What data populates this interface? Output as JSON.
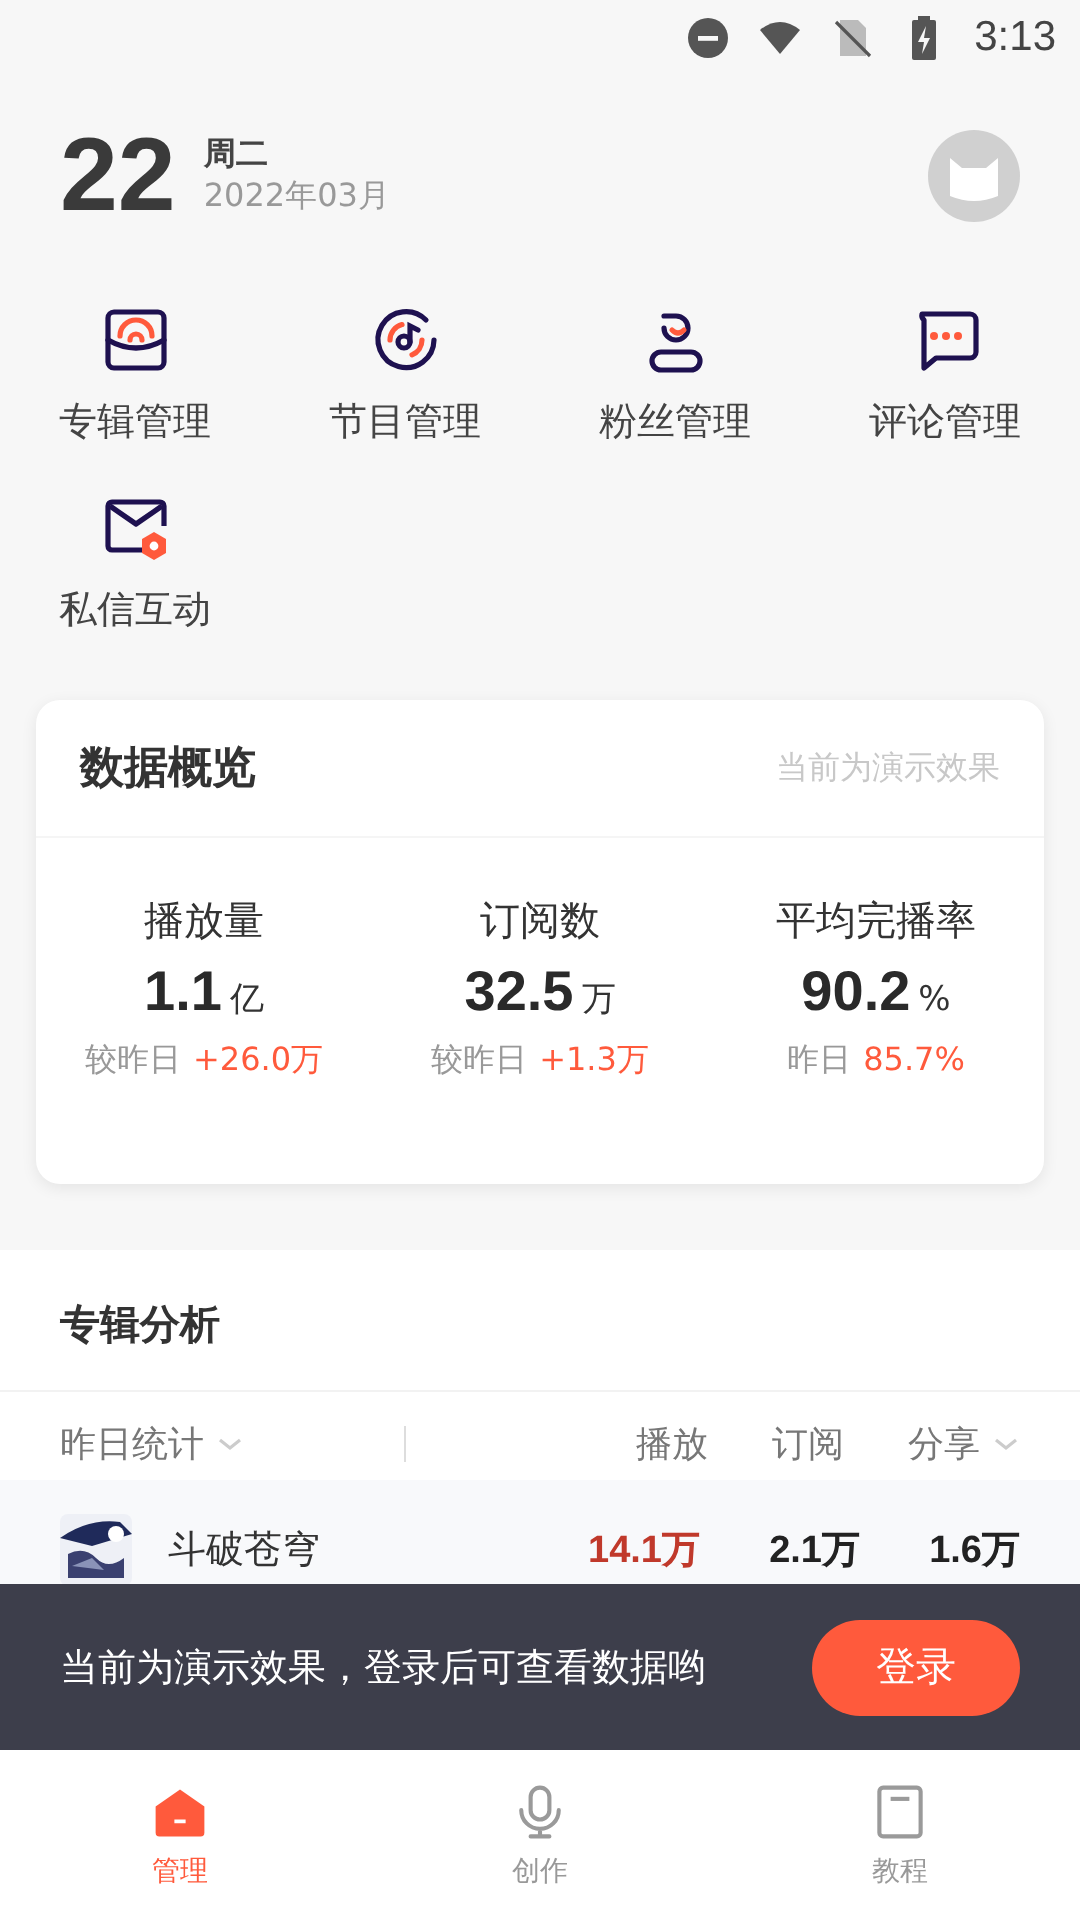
{
  "status_bar": {
    "time": "3:13"
  },
  "header": {
    "day": "22",
    "weekday": "周二",
    "month": "2022年03月"
  },
  "shortcuts": [
    {
      "label": "专辑管理",
      "kind": "album"
    },
    {
      "label": "节目管理",
      "kind": "program"
    },
    {
      "label": "粉丝管理",
      "kind": "fans"
    },
    {
      "label": "评论管理",
      "kind": "comment"
    },
    {
      "label": "私信互动",
      "kind": "message"
    }
  ],
  "overview": {
    "title": "数据概览",
    "note": "当前为演示效果",
    "stats": [
      {
        "label": "播放量",
        "value": "1.1",
        "unit": "亿",
        "compare_label": "较昨日",
        "compare_value": "+26.0万"
      },
      {
        "label": "订阅数",
        "value": "32.5",
        "unit": "万",
        "compare_label": "较昨日",
        "compare_value": "+1.3万"
      },
      {
        "label": "平均完播率",
        "value": "90.2",
        "unit": "%",
        "compare_label": "昨日",
        "compare_value": "85.7%"
      }
    ]
  },
  "album_analysis": {
    "title": "专辑分析",
    "filter": "昨日统计",
    "columns": [
      {
        "label": "播放",
        "dropdown": false,
        "highlighted": true
      },
      {
        "label": "订阅",
        "dropdown": false,
        "highlighted": false
      },
      {
        "label": "分享",
        "dropdown": true,
        "highlighted": false
      }
    ],
    "rows": [
      {
        "name": "斗破苍穹",
        "values": [
          "14.1万",
          "2.1万",
          "1.6万"
        ]
      }
    ]
  },
  "toast": {
    "message": "当前为演示效果，登录后可查看数据哟",
    "button": "登录"
  },
  "tabs": [
    {
      "label": "管理",
      "kind": "manage",
      "selected": true
    },
    {
      "label": "创作",
      "kind": "create",
      "selected": false
    },
    {
      "label": "教程",
      "kind": "tutorial",
      "selected": false
    }
  ]
}
